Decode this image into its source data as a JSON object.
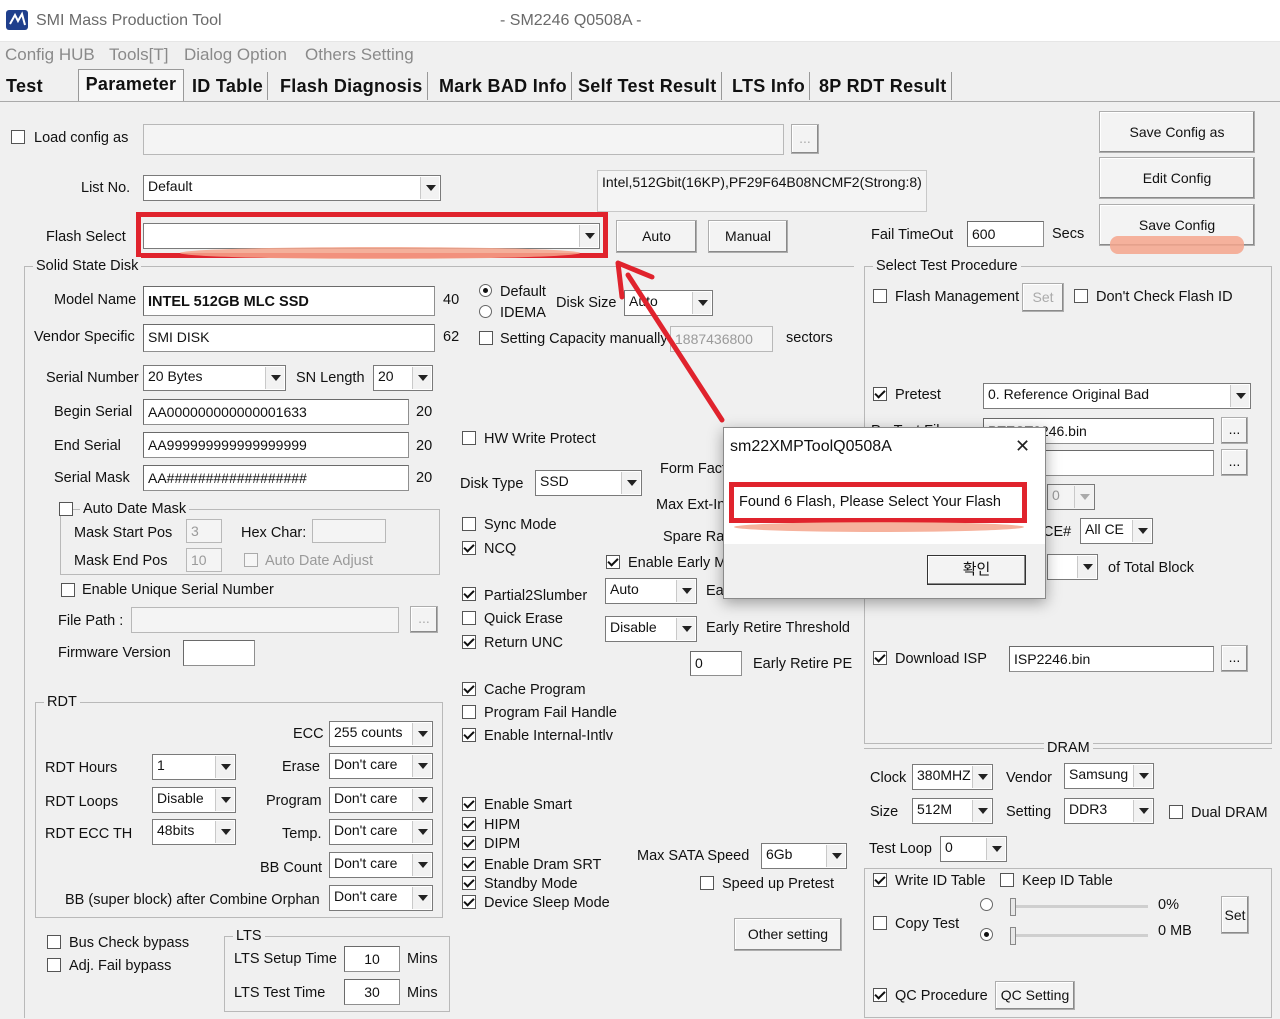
{
  "window": {
    "title": "SMI Mass Production Tool",
    "subtitle": "- SM2246 Q0508A -"
  },
  "menu": [
    "Config HUB",
    "Tools[T]",
    "Dialog Option",
    "Others Setting"
  ],
  "tabs": [
    "Test",
    "Parameter",
    "ID Table",
    "Flash Diagnosis",
    "Mark BAD Info",
    "Self Test Result",
    "LTS Info",
    "8P RDT Result"
  ],
  "top": {
    "load_config": "Load config as",
    "list_no": "List No.",
    "list_value": "Default",
    "flash_info": "Intel,512Gbit(16KP),PF29F64B08NCMF2(Strong:8)",
    "flash_select": "Flash Select",
    "auto": "Auto",
    "manual": "Manual",
    "fail_timeout": "Fail TimeOut",
    "fail_value": "600",
    "secs": "Secs",
    "save_as": "Save Config as",
    "edit": "Edit Config",
    "save": "Save Config",
    "browse": "..."
  },
  "ssd": {
    "legend": "Solid State Disk",
    "model_name": "Model Name",
    "model_value": "INTEL 512GB MLC SSD",
    "model_len": "40",
    "vendor": "Vendor Specific",
    "vendor_value": "SMI DISK",
    "vendor_len": "62",
    "serial": "Serial Number",
    "serial_value": "20 Bytes",
    "sn_length": "SN Length",
    "sn_value": "20",
    "begin": "Begin Serial",
    "begin_value": "AA000000000000001633",
    "end": "End Serial",
    "end_value": "AA999999999999999999",
    "mask": "Serial Mask",
    "mask_value": "AA##################",
    "len20": "20",
    "auto_date": "Auto Date Mask",
    "mask_start": "Mask Start Pos",
    "mask_start_v": "3",
    "mask_end": "Mask End Pos",
    "mask_end_v": "10",
    "hex": "Hex Char:",
    "auto_adjust": "Auto Date Adjust",
    "unique": "Enable Unique Serial Number",
    "file_path": "File Path :",
    "firmware": "Firmware Version"
  },
  "disk": {
    "default": "Default",
    "idema": "IDEMA",
    "disk_size": "Disk Size",
    "size_value": "Auto",
    "setting_cap": "Setting Capacity manually",
    "cap_value": "1887436800",
    "sectors": "sectors",
    "hw_write": "HW Write Protect",
    "disk_type": "Disk Type",
    "type_value": "SSD",
    "form": "Form Fact",
    "maxext": "Max Ext-In",
    "spare": "Spare Ra",
    "sync": "Sync Mode",
    "ncq": "NCQ",
    "early": "Enable Early M",
    "partial": "Partial2Slumber",
    "partial_v": "Auto",
    "ea": "Ea",
    "quick": "Quick Erase",
    "disable": "Disable",
    "ert": "Early Retire Threshold",
    "return_unc": "Return UNC",
    "pe_v": "0",
    "erpe": "Early Retire PE",
    "cache": "Cache Program",
    "pfh": "Program Fail Handle",
    "eii": "Enable Internal-Intlv",
    "smart": "Enable Smart",
    "hipm": "HIPM",
    "dipm": "DIPM",
    "srt": "Enable Dram SRT",
    "standby": "Standby Mode",
    "sleep": "Device Sleep Mode",
    "max_sata": "Max SATA Speed",
    "sata_v": "6Gb",
    "speedup": "Speed up Pretest",
    "other": "Other setting"
  },
  "rdt": {
    "legend": "RDT",
    "hours": "RDT Hours",
    "hours_v": "1",
    "loops": "RDT Loops",
    "loops_v": "Disable",
    "eccth": "RDT ECC TH",
    "eccth_v": "48bits",
    "ecc": "ECC",
    "ecc_v": "255 counts",
    "erase": "Erase",
    "program": "Program",
    "temp": "Temp.",
    "bbcount": "BB Count",
    "bbsuper": "BB (super block) after Combine Orphan",
    "dontcare": "Don't care",
    "bus": "Bus Check bypass",
    "adj": "Adj. Fail bypass"
  },
  "lts": {
    "legend": "LTS",
    "setup": "LTS Setup Time",
    "setup_v": "10",
    "test": "LTS Test Time",
    "test_v": "30",
    "mins": "Mins"
  },
  "proc": {
    "legend": "Select Test Procedure",
    "flash_mgmt": "Flash Management",
    "set": "Set",
    "dont_check": "Don't Check Flash ID",
    "pretest": "Pretest",
    "pretest_v": "0. Reference Original Bad",
    "pretest_file": "PreTest File :",
    "file1": "PTEST2246.bin",
    "file2": "246.bin",
    "zero": "0",
    "ce": "CE#",
    "allce": "All CE",
    "total": "of Total Block",
    "dl_isp": "Download ISP",
    "isp_v": "ISP2246.bin"
  },
  "dram": {
    "legend": "DRAM",
    "clock": "Clock",
    "clock_v": "380MHZ",
    "vendor": "Vendor",
    "vendor_v": "Samsung",
    "size": "Size",
    "size_v": "512M",
    "setting": "Setting",
    "setting_v": "DDR3",
    "dual": "Dual DRAM",
    "loop": "Test Loop",
    "loop_v": "0"
  },
  "bottom": {
    "write_id": "Write ID Table",
    "keep_id": "Keep ID Table",
    "copy": "Copy Test",
    "pct": "0%",
    "mb": "0 MB",
    "set": "Set",
    "qc": "QC Procedure",
    "qc_set": "QC Setting"
  },
  "dialog": {
    "title": "sm22XMPToolQ0508A",
    "message": "Found 6 Flash, Please Select Your Flash",
    "ok": "확인",
    "close": "✕"
  }
}
